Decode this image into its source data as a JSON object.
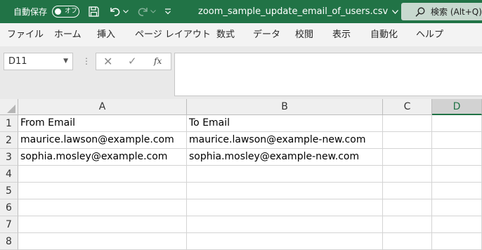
{
  "titlebar": {
    "autosave_label": "自動保存",
    "autosave_state": "オフ",
    "filename": "zoom_sample_update_email_of_users.csv",
    "search_label": "検索 (Alt+Q)",
    "icons": [
      "save-icon",
      "undo-icon",
      "redo-icon",
      "customize-toolbar-icon",
      "search-icon"
    ]
  },
  "menu": {
    "items": [
      "ファイル",
      "ホーム",
      "挿入",
      "ページ レイアウト",
      "数式",
      "データ",
      "校閲",
      "表示",
      "自動化",
      "ヘルプ"
    ]
  },
  "formula_bar": {
    "namebox": "D11",
    "dots": "⋮",
    "cancel": "✕",
    "enter": "✓",
    "fx": "fx",
    "content": ""
  },
  "sheet": {
    "columns": [
      "A",
      "B",
      "C",
      "D"
    ],
    "selected_column": "D",
    "rows": [
      {
        "num": "1",
        "A": "From Email",
        "B": "To Email",
        "C": "",
        "D": ""
      },
      {
        "num": "2",
        "A": "maurice.lawson@example.com",
        "B": "maurice.lawson@example-new.com",
        "C": "",
        "D": ""
      },
      {
        "num": "3",
        "A": "sophia.mosley@example.com",
        "B": "sophia.mosley@example-new.com",
        "C": "",
        "D": ""
      },
      {
        "num": "4",
        "A": "",
        "B": "",
        "C": "",
        "D": ""
      },
      {
        "num": "5",
        "A": "",
        "B": "",
        "C": "",
        "D": ""
      },
      {
        "num": "6",
        "A": "",
        "B": "",
        "C": "",
        "D": ""
      },
      {
        "num": "7",
        "A": "",
        "B": "",
        "C": "",
        "D": ""
      },
      {
        "num": "8",
        "A": "",
        "B": "",
        "C": "",
        "D": ""
      }
    ]
  },
  "colors": {
    "brand": "#217346",
    "menubar_bg": "#f3f3f3",
    "formula_bg": "#e9e9e9",
    "header_bg": "#efefef",
    "selected_header_bg": "#d2d2d2"
  }
}
